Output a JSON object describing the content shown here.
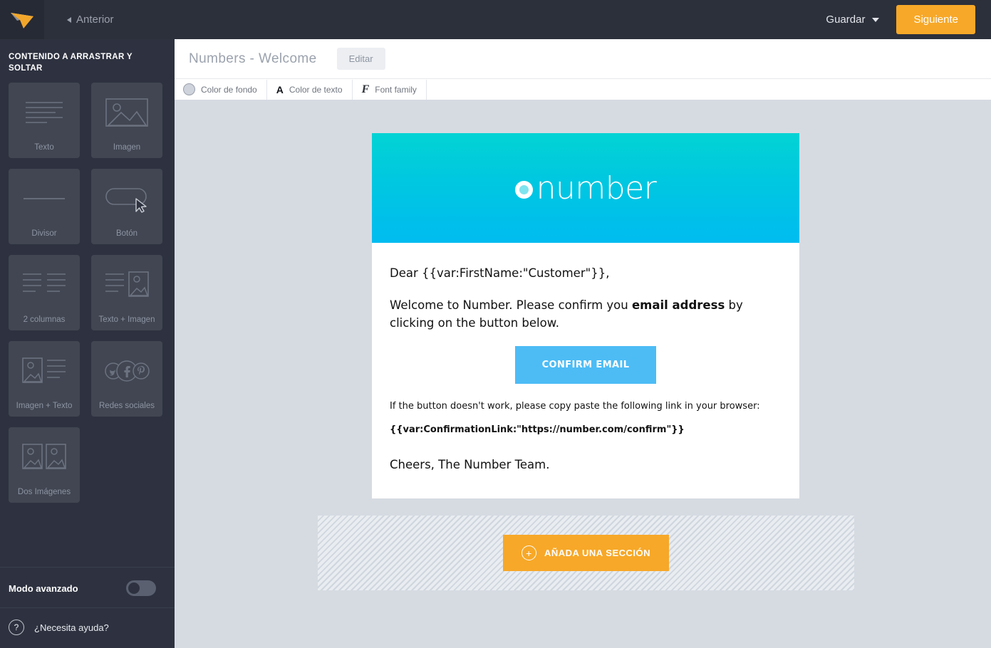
{
  "topbar": {
    "logo_icon": "paper-plane-logo",
    "previous_label": "Anterior",
    "save_label": "Guardar",
    "next_label": "Siguiente",
    "accent_orange": "#f7a828",
    "background": "#2c303b"
  },
  "sidebar": {
    "title": "CONTENIDO A ARRASTRAR Y SOLTAR",
    "blocks": [
      {
        "label": "Texto",
        "icon": "text-lines-icon"
      },
      {
        "label": "Imagen",
        "icon": "image-icon"
      },
      {
        "label": "Divisor",
        "icon": "divider-line-icon"
      },
      {
        "label": "Botón",
        "icon": "button-pill-cursor-icon"
      },
      {
        "label": "2 columnas",
        "icon": "two-columns-icon"
      },
      {
        "label": "Texto + Imagen",
        "icon": "text-image-icon"
      },
      {
        "label": "Imagen + Texto",
        "icon": "image-text-icon"
      },
      {
        "label": "Redes sociales",
        "icon": "social-networks-icon"
      },
      {
        "label": "Dos Imágenes",
        "icon": "two-images-icon"
      }
    ],
    "advanced_mode_label": "Modo avanzado",
    "advanced_mode_on": false,
    "help_label": "¿Necesita ayuda?",
    "help_icon": "question-mark-icon",
    "background": "#2e3240",
    "block_background": "#414652"
  },
  "editor": {
    "doc_title": "Numbers - Welcome",
    "edit_label": "Editar",
    "toolbar": [
      {
        "label": "Color de fondo",
        "icon": "color-swatch-icon"
      },
      {
        "label": "Color de texto",
        "icon": "text-color-A-icon"
      },
      {
        "label": "Font family",
        "icon": "font-family-F-icon"
      }
    ],
    "canvas_background": "#d6dbe2"
  },
  "email": {
    "hero": {
      "logo_text": "number",
      "logo_mark_icon": "number-ring-icon",
      "gradient_from": "#02d3d4",
      "gradient_to": "#00bcf0"
    },
    "greeting": "Dear {{var:FirstName:\"Customer\"}},",
    "intro_prefix": "Welcome to Number. Please confirm you ",
    "intro_bold": "email address",
    "intro_suffix": " by clicking on the button below.",
    "cta_label": "CONFIRM EMAIL",
    "cta_color": "#4dbcf5",
    "fallback_text": "If the button doesn't work, please copy paste the following link in your browser:",
    "link_variable": "{{var:ConfirmationLink:\"https://number.com/confirm\"}}",
    "signoff": "Cheers, The Number Team."
  },
  "add_section": {
    "label": "AÑADA UNA SECCIÓN",
    "icon": "plus-circle-icon",
    "color": "#f7a828"
  }
}
